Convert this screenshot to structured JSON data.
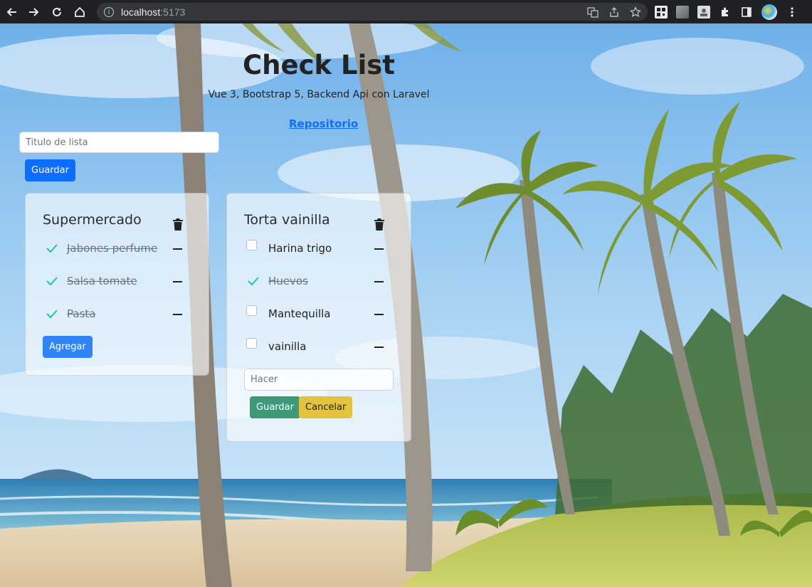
{
  "browser": {
    "url_host": "localhost",
    "url_port": ":5173"
  },
  "app": {
    "title": "Check List",
    "subtitle": "Vue 3, Bootstrap 5, Backend Api con Laravel",
    "repo_link": "Repositorio",
    "new_list_placeholder": "Titulo de lista",
    "save_list_label": "Guardar"
  },
  "lists": [
    {
      "title": "Supermercado",
      "items": [
        {
          "text": "Jabones perfume",
          "done": true
        },
        {
          "text": "Salsa tomate",
          "done": true
        },
        {
          "text": "Pasta",
          "done": true
        }
      ],
      "add_label": "Agregar"
    },
    {
      "title": "Torta vainilla",
      "items": [
        {
          "text": "Harina trigo",
          "done": false
        },
        {
          "text": "Huevos",
          "done": true
        },
        {
          "text": "Mantequilla",
          "done": false
        },
        {
          "text": "vainilla",
          "done": false
        }
      ],
      "new_item_placeholder": "Hacer",
      "save_label": "Guardar",
      "cancel_label": "Cancelar"
    }
  ],
  "colors": {
    "primary": "#0d6efd",
    "success": "#198754",
    "warning": "#ffc107",
    "check": "#20c997"
  }
}
